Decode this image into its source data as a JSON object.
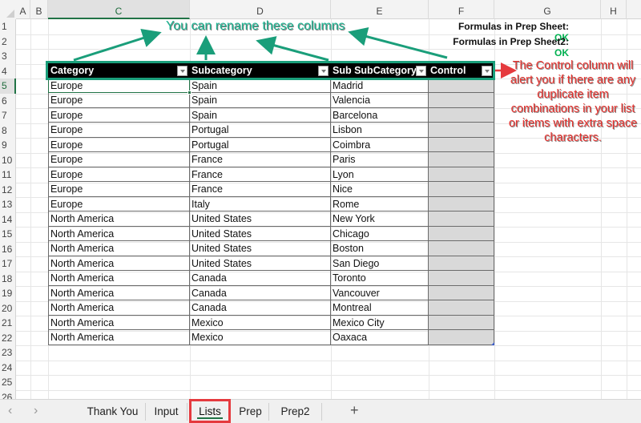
{
  "sheet": {
    "column_headers": [
      "A",
      "B",
      "C",
      "D",
      "E",
      "F",
      "G",
      "H"
    ],
    "active_column": "C",
    "row_numbers": [
      "1",
      "2",
      "3",
      "4",
      "5",
      "6",
      "7",
      "8",
      "9",
      "10",
      "11",
      "12",
      "13",
      "14",
      "15",
      "16",
      "17",
      "18",
      "19",
      "20",
      "21",
      "22",
      "23",
      "24",
      "25",
      "26"
    ],
    "active_row": "5"
  },
  "status": {
    "prep_label": "Formulas in Prep Sheet:",
    "prep_value": "OK",
    "prep2_label": "Formulas in Prep Sheet2:",
    "prep2_value": "OK",
    "ok_color": "#00b050"
  },
  "table": {
    "headers": [
      "Category",
      "Subcategory",
      "Sub SubCategory",
      "Control"
    ],
    "rows": [
      [
        "Europe",
        "Spain",
        "Madrid",
        ""
      ],
      [
        "Europe",
        "Spain",
        "Valencia",
        ""
      ],
      [
        "Europe",
        "Spain",
        "Barcelona",
        ""
      ],
      [
        "Europe",
        "Portugal",
        "Lisbon",
        ""
      ],
      [
        "Europe",
        "Portugal",
        "Coimbra",
        ""
      ],
      [
        "Europe",
        "France",
        "Paris",
        ""
      ],
      [
        "Europe",
        "France",
        "Lyon",
        ""
      ],
      [
        "Europe",
        "France",
        "Nice",
        ""
      ],
      [
        "Europe",
        "Italy",
        "Rome",
        ""
      ],
      [
        "North America",
        "United States",
        "New York",
        ""
      ],
      [
        "North America",
        "United States",
        "Chicago",
        ""
      ],
      [
        "North America",
        "United States",
        "Boston",
        ""
      ],
      [
        "North America",
        "United States",
        "San Diego",
        ""
      ],
      [
        "North America",
        "Canada",
        "Toronto",
        ""
      ],
      [
        "North America",
        "Canada",
        "Vancouver",
        ""
      ],
      [
        "North America",
        "Canada",
        "Montreal",
        ""
      ],
      [
        "North America",
        "Mexico",
        "Mexico City",
        ""
      ],
      [
        "North America",
        "Mexico",
        "Oaxaca",
        ""
      ]
    ]
  },
  "annotations": {
    "rename_note": "You can rename these columns",
    "control_note": "The Control column will alert you if there are any duplicate item combinations in your list or items with extra space characters.",
    "green_color": "#1bb592",
    "red_color": "#e8332f"
  },
  "tabs": {
    "prev_icon": "‹",
    "next_icon": "›",
    "items": [
      "Thank You",
      "Input",
      "Lists",
      "Prep",
      "Prep2"
    ],
    "active": "Lists",
    "add_icon": "+"
  }
}
